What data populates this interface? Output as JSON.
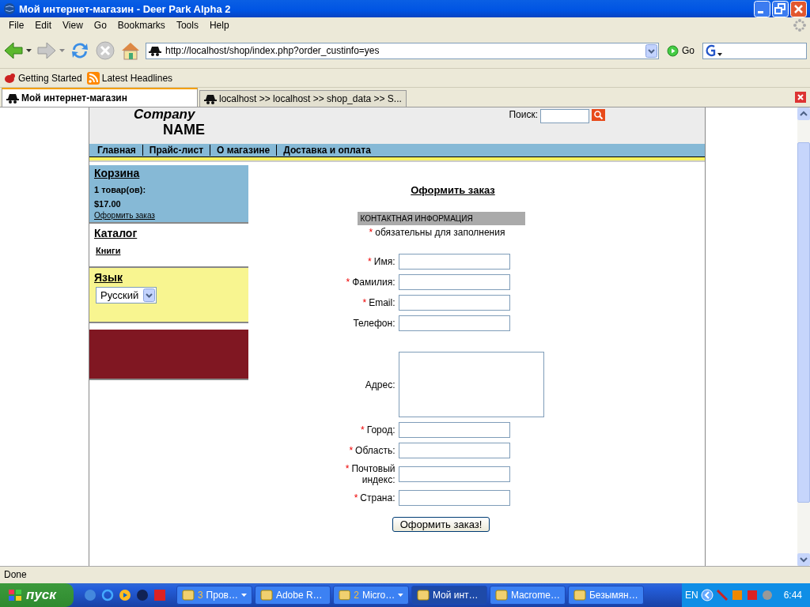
{
  "window": {
    "title": "Мой интернет-магазин - Deer Park Alpha 2"
  },
  "menu": [
    "File",
    "Edit",
    "View",
    "Go",
    "Bookmarks",
    "Tools",
    "Help"
  ],
  "toolbar": {
    "address": "http://localhost/shop/index.php?order_custinfo=yes",
    "go": "Go"
  },
  "bookmarks": [
    "Getting Started",
    "Latest Headlines"
  ],
  "tabs": [
    {
      "label": "Мой интернет-магазин",
      "selected": true
    },
    {
      "label": "localhost >> localhost >> shop_data  >> S...",
      "selected": false
    }
  ],
  "page": {
    "logo": [
      "Company",
      "NAME"
    ],
    "search_label": "Поиск:",
    "nav": [
      "Главная",
      "Прайс-лист",
      "О магазине",
      "Доставка и оплата"
    ],
    "cart": {
      "title": "Корзина",
      "count": "1 товар(ов):",
      "total": "$17.00",
      "link": "Оформить заказ"
    },
    "catalog": {
      "title": "Каталог",
      "items": [
        "Книги"
      ]
    },
    "language": {
      "title": "Язык",
      "value": "Русский"
    },
    "form": {
      "title": "Оформить заказ",
      "section": "КОНТАКТНАЯ ИНФОРМАЦИЯ",
      "required_mark": "*",
      "required_note": "обязательны для заполнения",
      "fields": [
        {
          "label": "Имя:",
          "required": true,
          "kind": "text"
        },
        {
          "label": "Фамилия:",
          "required": true,
          "kind": "text"
        },
        {
          "label": "Email:",
          "required": true,
          "kind": "text"
        },
        {
          "label": "Телефон:",
          "required": false,
          "kind": "text"
        },
        {
          "label": "Адрес:",
          "required": false,
          "kind": "textarea"
        },
        {
          "label": "Город:",
          "required": true,
          "kind": "text"
        },
        {
          "label": "Область:",
          "required": true,
          "kind": "text"
        },
        {
          "label": "Почтовый индекс:",
          "required": true,
          "kind": "text"
        },
        {
          "label": "Страна:",
          "required": true,
          "kind": "text"
        }
      ],
      "submit": "Оформить заказ!"
    }
  },
  "status_bar": "Done",
  "taskbar": {
    "start": "пуск",
    "tasks": [
      {
        "count": "3",
        "label": "Пров…",
        "group": true,
        "selected": false
      },
      {
        "label": "Adobe R…",
        "group": false,
        "selected": false
      },
      {
        "count": "2",
        "label": "Micro…",
        "group": true,
        "selected": false
      },
      {
        "label": "Мой инт…",
        "group": false,
        "selected": true
      },
      {
        "label": "Macrome…",
        "group": false,
        "selected": false
      },
      {
        "label": "Безымян…",
        "group": false,
        "selected": false
      }
    ],
    "language": "EN",
    "clock": "6:44"
  }
}
